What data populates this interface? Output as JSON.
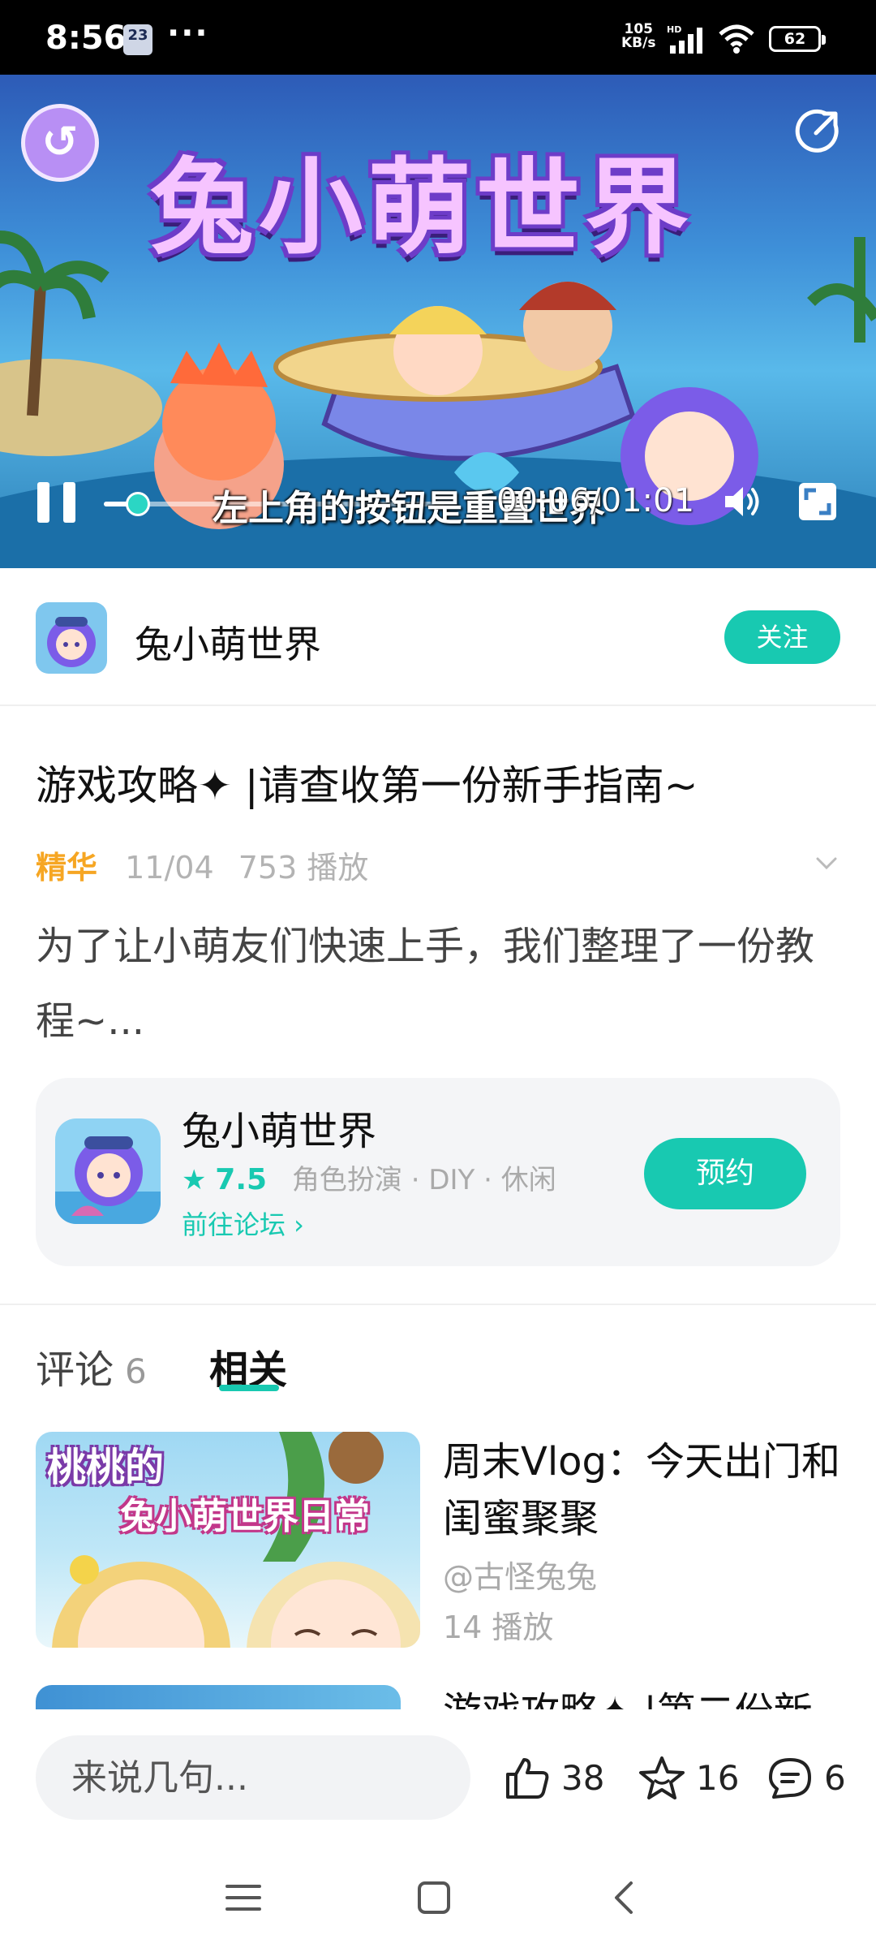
{
  "status_bar": {
    "time": "8:56",
    "calendar_badge": "23",
    "overflow": "···",
    "net_speed_value": "105",
    "net_speed_unit": "KB/s",
    "battery": "62"
  },
  "video": {
    "poster_title": "兔小萌世界",
    "subtitle": "左上角的按钮是重置世界",
    "time_display": "00:06/01:01",
    "progress": 0.1,
    "reset_icon": "reset-world-icon",
    "share_icon": "share-icon",
    "pause_icon": "pause-icon",
    "volume_icon": "volume-icon",
    "fullscreen_icon": "fullscreen-icon"
  },
  "channel": {
    "name": "兔小萌世界",
    "follow_label": "关注"
  },
  "post": {
    "title": "游戏攻略✦ |请查收第一份新手指南~",
    "tag": "精华",
    "date": "11/04",
    "plays": "753 播放",
    "description": "为了让小萌友们快速上手，我们整理了一份教程~..."
  },
  "game_card": {
    "name": "兔小萌世界",
    "star": "★",
    "rating": "7.5",
    "tags": "角色扮演 · DIY · 休闲",
    "forum_link": "前往论坛 ›",
    "action_label": "预约"
  },
  "tabs": {
    "comments_label": "评论",
    "comments_count": "6",
    "related_label": "相关"
  },
  "related": [
    {
      "thumb_line1": "桃桃的",
      "thumb_line2": "兔小萌世界日常",
      "title": "周末Vlog：今天出门和闺蜜聚聚",
      "author": "@古怪兔兔",
      "plays": "14 播放"
    },
    {
      "title": "游戏攻略✦ |第二份新"
    }
  ],
  "bottom_bar": {
    "input_placeholder": "来说几句...",
    "likes": "38",
    "favorites": "16",
    "comments": "6"
  },
  "colors": {
    "accent": "#18c9b1",
    "highlight_tag": "#f6a623",
    "status_bar_bg": "#000000"
  }
}
